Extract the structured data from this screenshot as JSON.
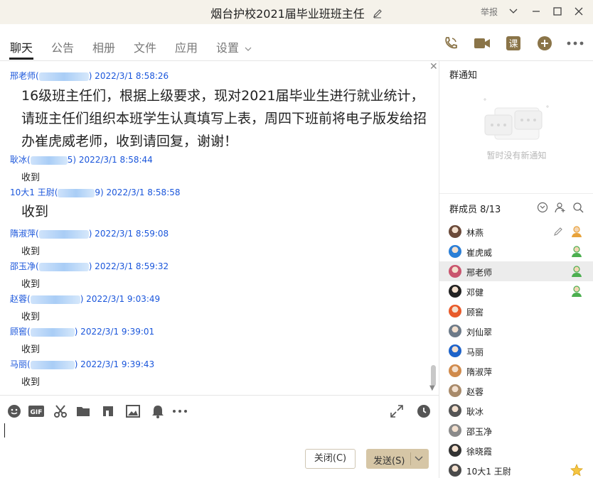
{
  "window": {
    "title": "烟台护校2021届毕业班班主任",
    "report_label": "举报"
  },
  "tabs": [
    {
      "label": "聊天",
      "active": true
    },
    {
      "label": "公告"
    },
    {
      "label": "相册"
    },
    {
      "label": "文件"
    },
    {
      "label": "应用"
    },
    {
      "label": "设置"
    }
  ],
  "toolbar_icons": [
    "voice-call-icon",
    "video-call-icon",
    "class-icon",
    "add-icon",
    "more-icon"
  ],
  "messages": [
    {
      "name": "邢老师(",
      "time": ") 2022/3/1 8:58:26",
      "text": "16级班主任们，根据上级要求，现对2021届毕业生进行就业统计，请班主任们组织本班学生认真填写上表，周四下班前将电子版发给招办崔虎威老师，收到请回复，谢谢！",
      "big": true
    },
    {
      "name": "耿冰(",
      "time": "5) 2022/3/1 8:58:44",
      "text": "收到"
    },
    {
      "name": "10大1  王尉(",
      "time": "9) 2022/3/1 8:58:58",
      "text": "收到",
      "big": true
    },
    {
      "name": "隋淑萍(",
      "time": ") 2022/3/1 8:59:08",
      "text": "收到"
    },
    {
      "name": "邵玉净(",
      "time": ") 2022/3/1 8:59:32",
      "text": "收到"
    },
    {
      "name": "赵蓉(",
      "time": ") 2022/3/1 9:03:49",
      "text": "收到"
    },
    {
      "name": "顾窖(",
      "time": ") 2022/3/1 9:39:01",
      "text": "收到"
    },
    {
      "name": "马丽(",
      "time": ") 2022/3/1 9:39:43",
      "text": "收到"
    }
  ],
  "composer": {
    "close_label": "关闭(C)",
    "send_label": "发送(S)"
  },
  "notice": {
    "title": "群通知",
    "empty_text": "暂时没有新通知"
  },
  "members": {
    "title": "群成员 8/13",
    "list": [
      {
        "name": "林燕",
        "role": "owner",
        "color": "#6b4a3a"
      },
      {
        "name": "崔虎威",
        "role": "admin",
        "color": "#2b7fd6"
      },
      {
        "name": "邢老师",
        "role": "admin",
        "color": "#c9556e",
        "selected": true
      },
      {
        "name": "邓健",
        "role": "admin",
        "color": "#222222"
      },
      {
        "name": "顾窖",
        "role": "",
        "color": "#e85a2a"
      },
      {
        "name": "刘仙翠",
        "role": "",
        "color": "#6d7a88"
      },
      {
        "name": "马丽",
        "role": "",
        "color": "#1e63c9"
      },
      {
        "name": "隋淑萍",
        "role": "",
        "color": "#d08a4b"
      },
      {
        "name": "赵蓉",
        "role": "",
        "color": "#a88a6a"
      },
      {
        "name": "耿冰",
        "role": "",
        "color": "#555555"
      },
      {
        "name": "邵玉净",
        "role": "",
        "color": "#8a8a8a"
      },
      {
        "name": "徐晓霞",
        "role": "",
        "color": "#333333"
      },
      {
        "name": "10大1  王尉",
        "role": "star",
        "color": "#4a4a4a"
      }
    ]
  }
}
